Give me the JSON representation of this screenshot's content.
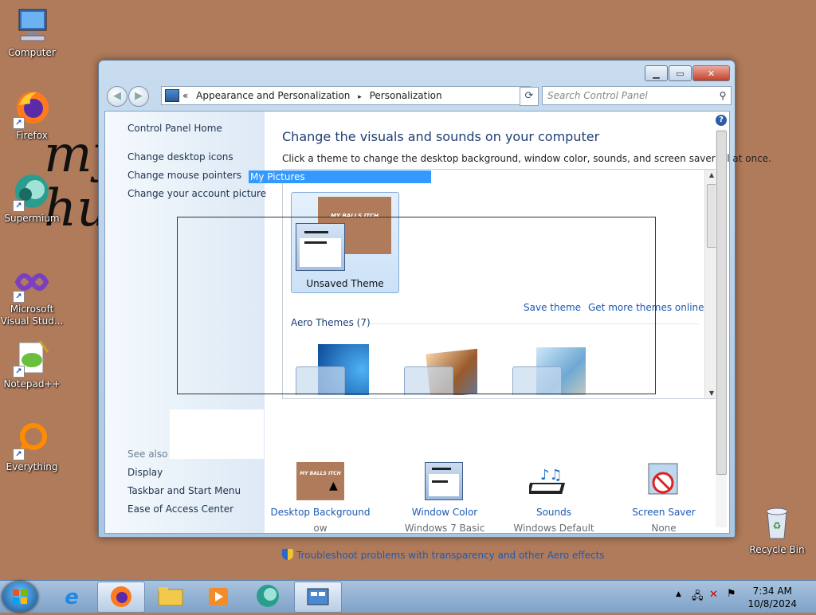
{
  "desktop": {
    "overlay_text": "my\nhu",
    "icons": [
      {
        "label": "Computer"
      },
      {
        "label": "Firefox"
      },
      {
        "label": "Supermium"
      },
      {
        "label": "Microsoft Visual Stud..."
      },
      {
        "label": "Notepad++"
      },
      {
        "label": "Everything"
      },
      {
        "label": "Recycle Bin"
      }
    ]
  },
  "window": {
    "breadcrumb": {
      "prefix": "«",
      "items": [
        "Appearance and Personalization",
        "Personalization"
      ],
      "separator": "▸"
    },
    "search_placeholder": "Search Control Panel",
    "left_pane": {
      "home": "Control Panel Home",
      "links": [
        "Change desktop icons",
        "Change mouse pointers",
        "Change your account picture"
      ],
      "see_also_label": "See also",
      "see_also": [
        "Display",
        "Taskbar and Start Menu",
        "Ease of Access Center"
      ]
    },
    "main": {
      "title": "Change the visuals and sounds on your computer",
      "subtitle": "Click a theme to change the desktop background, window color, sounds, and screen saver all at once.",
      "selected_theme": {
        "label": "Unsaved Theme",
        "thumb_text": "MY BALLS ITCH"
      },
      "save_theme": "Save theme",
      "get_more": "Get more themes online",
      "aero_header": "Aero Themes (7)",
      "bottom": [
        {
          "title": "Desktop Background",
          "value": "ow",
          "thumb_text": "MY BALLS ITCH"
        },
        {
          "title": "Window Color",
          "value": "Windows 7 Basic"
        },
        {
          "title": "Sounds",
          "value": "Windows Default"
        },
        {
          "title": "Screen Saver",
          "value": "None"
        }
      ],
      "troubleshoot": "Troubleshoot problems with transparency and other Aero effects"
    }
  },
  "drag_label": "My Pictures",
  "taskbar": {
    "time": "7:34 AM",
    "date": "10/8/2024"
  },
  "colors": {
    "desktop": "#b07b5b",
    "link": "#1a5ab6",
    "selection": "#3399ff"
  }
}
